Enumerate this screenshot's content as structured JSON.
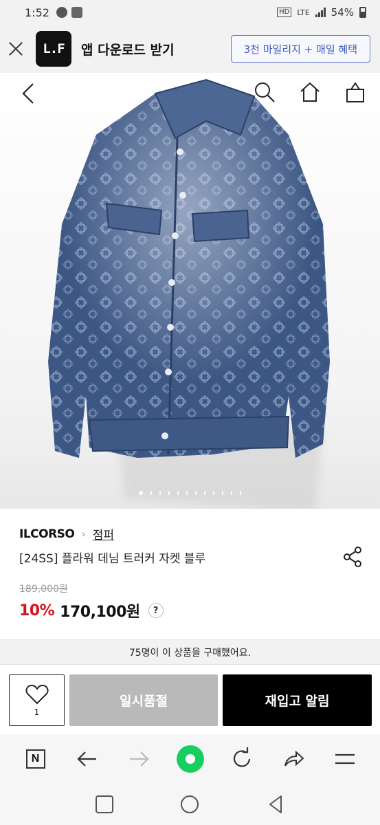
{
  "status_bar": {
    "time": "1:52",
    "hd_label": "HD",
    "lte_label": "LTE",
    "battery": "54%"
  },
  "app_banner": {
    "logo_text": "L.F",
    "title": "앱 다운로드 받기",
    "promo_label": "3천 마일리지 + 매일 혜택"
  },
  "gallery": {
    "total_images": 12,
    "current_index": 1
  },
  "product": {
    "brand": "ILCORSO",
    "category": "점퍼",
    "name": "[24SS] 플라워 데님 트러커 자켓 블루",
    "original_price": "189,000원",
    "discount": "10%",
    "price": "170,100원",
    "help_label": "?",
    "purchase_notice": "75명이 이 상품을 구매했어요."
  },
  "actions": {
    "like_count": "1",
    "soldout_label": "일시품절",
    "restock_label": "재입고 알림"
  },
  "browser_toolbar": {
    "home_label": "N"
  },
  "colors": {
    "discount": "#d5151d",
    "promo_border": "#5b74c8",
    "green_button": "#19ce60"
  }
}
